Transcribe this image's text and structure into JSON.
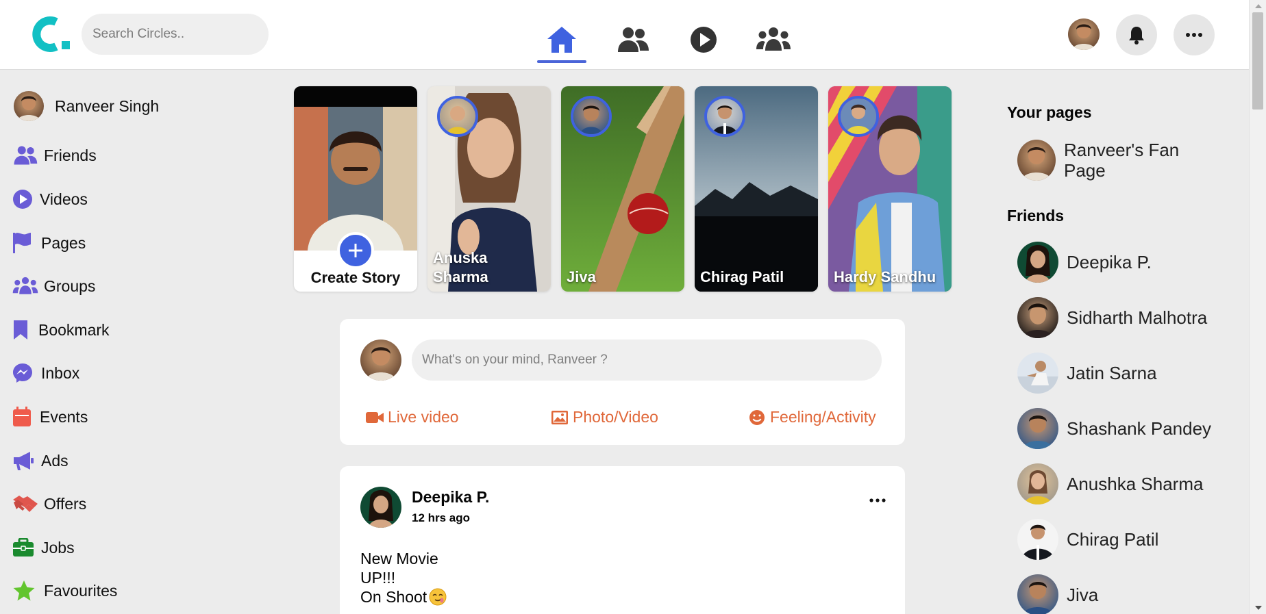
{
  "app": {
    "logo_text": "c.",
    "search_placeholder": "Search Circles.."
  },
  "nav": {
    "items": [
      {
        "icon": "home-icon",
        "active": true
      },
      {
        "icon": "friends-icon",
        "active": false
      },
      {
        "icon": "play-icon",
        "active": false
      },
      {
        "icon": "groups-icon",
        "active": false
      }
    ]
  },
  "header_right": {
    "icons": [
      "avatar",
      "bell-icon",
      "more-icon"
    ]
  },
  "sidebar": {
    "user_name": "Ranveer Singh",
    "items": [
      {
        "label": "Friends",
        "icon": "friends-icon"
      },
      {
        "label": "Videos",
        "icon": "play-circle-icon"
      },
      {
        "label": "Pages",
        "icon": "flag-icon"
      },
      {
        "label": "Groups",
        "icon": "groups-icon"
      },
      {
        "label": "Bookmark",
        "icon": "bookmark-icon"
      },
      {
        "label": "Inbox",
        "icon": "messenger-icon"
      },
      {
        "label": "Events",
        "icon": "calendar-icon"
      },
      {
        "label": "Ads",
        "icon": "megaphone-icon"
      },
      {
        "label": "Offers",
        "icon": "handshake-icon"
      },
      {
        "label": "Jobs",
        "icon": "briefcase-icon"
      },
      {
        "label": "Favourites",
        "icon": "star-icon"
      }
    ]
  },
  "stories": {
    "create_label": "Create Story",
    "items": [
      {
        "name": "Anuska Sharma"
      },
      {
        "name": "Jiva"
      },
      {
        "name": "Chirag Patil"
      },
      {
        "name": "Hardy Sandhu"
      }
    ]
  },
  "composer": {
    "placeholder": "What's on your mind, Ranveer ?",
    "actions": [
      {
        "label": "Live video",
        "icon": "video-camera-icon"
      },
      {
        "label": "Photo/Video",
        "icon": "image-icon"
      },
      {
        "label": "Feeling/Activity",
        "icon": "smile-icon"
      }
    ]
  },
  "post": {
    "author": "Deepika P.",
    "time": "12 hrs ago",
    "lines": [
      "New Movie",
      "UP!!!",
      "On Shoot"
    ]
  },
  "right_sidebar": {
    "pages_heading": "Your pages",
    "page_name": "Ranveer's Fan Page",
    "friends_heading": "Friends",
    "friends": [
      "Deepika P.",
      "Sidharth Malhotra",
      "Jatin Sarna",
      "Shashank Pandey",
      "Anushka Sharma",
      "Chirag Patil",
      "Jiva"
    ]
  },
  "colors": {
    "accent": "#3f62e0",
    "sidebar_icon": "#6a5cd6",
    "composer_action": "#e0683a",
    "logo": "#12c0c4"
  }
}
